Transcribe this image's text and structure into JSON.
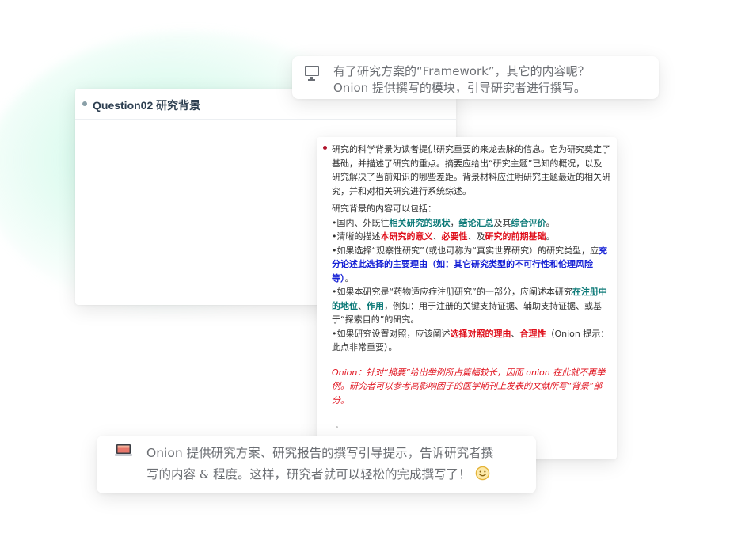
{
  "top_bubble": {
    "icon": "monitor-icon",
    "line1": "有了研究方案的“Framework”，其它的内容呢？",
    "line2": "Onion 提供撰写的模块，引导研究者进行撰写。"
  },
  "question_card": {
    "title": "Question02 研究背景"
  },
  "content_card": {
    "intro": "研究的科学背景为读者提供研究重要的来龙去脉的信息。它为研究奠定了基础，并描述了研究的重点。摘要应给出“研究主题”已知的概况，以及研究解决了当前知识的哪些差距。背景材料应注明研究主题最近的相关研究，并和对相关研究进行系统综述。",
    "list_heading": "研究背景的内容可以包括：",
    "item1": {
      "a": "•国内、外既往",
      "b": "相关研究的现状",
      "c": "，",
      "d": "结论汇总",
      "e": "及其",
      "f": "综合评价",
      "g": "。"
    },
    "item2": {
      "a": "•清晰的描述",
      "b": "本研究的意义",
      "c": "、",
      "d": "必要性",
      "e": "、及",
      "f": "研究的前期基础",
      "g": "。"
    },
    "item3": {
      "a": "•如果选择“观察性研究”（或也可称为“真实世界研究）的研究类型，应",
      "b": "充分论述此选择的主要理由（如：其它研究类型的不可行性和伦理风险等）",
      "c": "。"
    },
    "item4": {
      "a": "•如果本研究是“药物适应症注册研究”的一部分，应阐述本研究",
      "b": "在注册中的地位",
      "c": "、",
      "d": "作用",
      "e": "，例如：用于注册的关键支持证据、辅助支持证据、或基于“探索目的”的研究。"
    },
    "item5": {
      "a": "•如果研究设置对照，应该阐述",
      "b": "选择对照的理由",
      "c": "、",
      "d": "合理性",
      "e": "（Onion 提示：此点非常重要）。"
    },
    "note": "Onion：针对“摘要”给出举例所占篇幅较长，因而 onion 在此就不再举例。研究者可以参考高影响因子的医学期刊上发表的文献所写“背景”部分。",
    "colors": {
      "teal": "#0d7a78",
      "red": "#e0101c",
      "blue": "#1722d6"
    }
  },
  "bottom_bubble": {
    "icon": "laptop-icon",
    "line1": "Onion 提供研究方案、研究报告的撰写引导提示，告诉研究者撰",
    "line2": "写的内容 & 程度。这样，研究者就可以轻松的完成撰写了！",
    "emoji": "smile-emoji-icon"
  }
}
